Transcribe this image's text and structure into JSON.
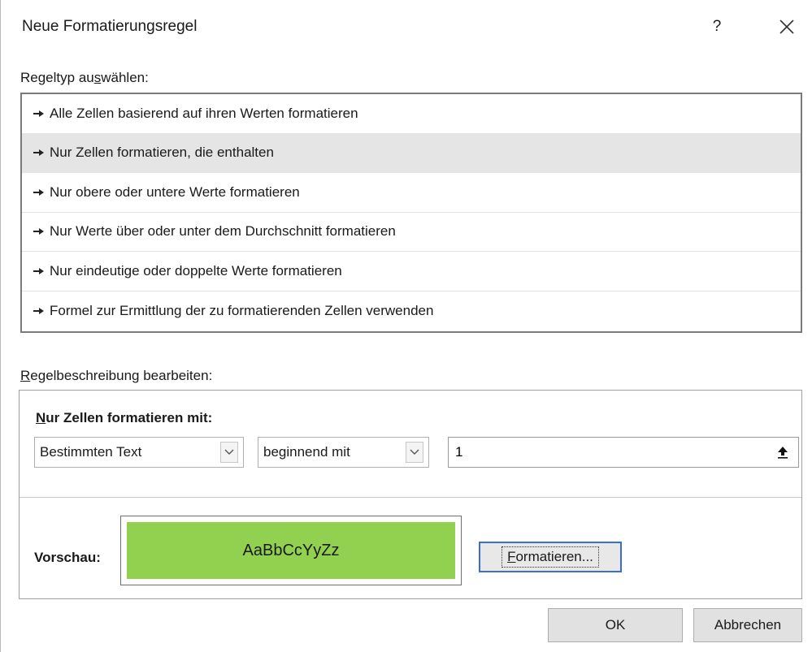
{
  "dialog": {
    "title": "Neue Formatierungsregel",
    "help_label": "?",
    "close_icon": "close-icon"
  },
  "rule_type": {
    "label_prefix": "Regeltyp au",
    "label_mnemonic": "s",
    "label_suffix": "wählen:",
    "selected_index": 1,
    "items": [
      {
        "label": "Alle Zellen basierend auf ihren Werten formatieren"
      },
      {
        "label": "Nur Zellen formatieren, die enthalten"
      },
      {
        "label": "Nur obere oder untere Werte formatieren"
      },
      {
        "label": "Nur Werte über oder unter dem Durchschnitt formatieren"
      },
      {
        "label": "Nur eindeutige oder doppelte Werte formatieren"
      },
      {
        "label": "Formel zur Ermittlung der zu formatierenden Zellen verwenden"
      }
    ]
  },
  "rule_description": {
    "label_mnemonic": "R",
    "label_suffix": "egelbeschreibung bearbeiten:",
    "heading_mnemonic": "N",
    "heading_suffix": "ur Zellen formatieren mit:",
    "condition_type": "Bestimmten Text",
    "operator": "beginnend mit",
    "value": "1",
    "preview_label": "Vorschau:",
    "preview_text": "AaBbCcYyZz",
    "preview_fill_color": "#92d050",
    "format_button_mnemonic": "F",
    "format_button_suffix": "ormatieren..."
  },
  "buttons": {
    "ok": "OK",
    "cancel": "Abbrechen"
  }
}
